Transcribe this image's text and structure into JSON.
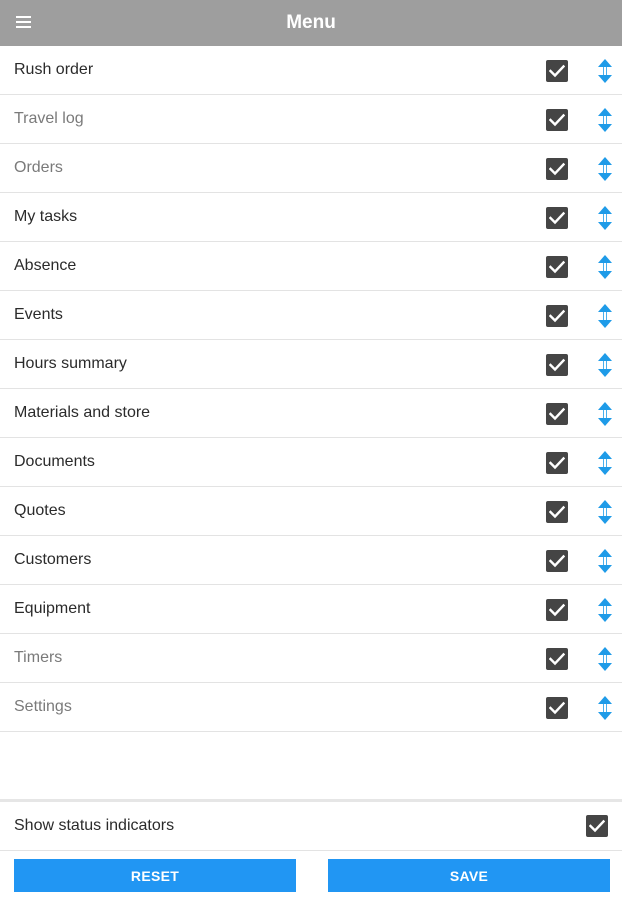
{
  "header": {
    "title": "Menu",
    "menu_icon": "hamburger-icon",
    "background": "#9e9e9e"
  },
  "menu_items": [
    {
      "label": "Rush order",
      "checked": true,
      "dim": false
    },
    {
      "label": "Travel log",
      "checked": true,
      "dim": true
    },
    {
      "label": "Orders",
      "checked": true,
      "dim": true
    },
    {
      "label": "My tasks",
      "checked": true,
      "dim": false
    },
    {
      "label": "Absence",
      "checked": true,
      "dim": false
    },
    {
      "label": "Events",
      "checked": true,
      "dim": false
    },
    {
      "label": "Hours summary",
      "checked": true,
      "dim": false
    },
    {
      "label": "Materials and store",
      "checked": true,
      "dim": false
    },
    {
      "label": "Documents",
      "checked": true,
      "dim": false
    },
    {
      "label": "Quotes",
      "checked": true,
      "dim": false
    },
    {
      "label": "Customers",
      "checked": true,
      "dim": false
    },
    {
      "label": "Equipment",
      "checked": true,
      "dim": false
    },
    {
      "label": "Timers",
      "checked": true,
      "dim": true
    },
    {
      "label": "Settings",
      "checked": true,
      "dim": true
    }
  ],
  "row_icons": {
    "checkbox": "checkbox-checked-icon",
    "reorder": "reorder-arrows-icon"
  },
  "status": {
    "label": "Show status indicators",
    "checked": true
  },
  "buttons": {
    "reset_label": "RESET",
    "save_label": "SAVE"
  },
  "colors": {
    "accent": "#2196f3",
    "reorder_icon": "#1e9be8",
    "checkbox": "#454545"
  }
}
